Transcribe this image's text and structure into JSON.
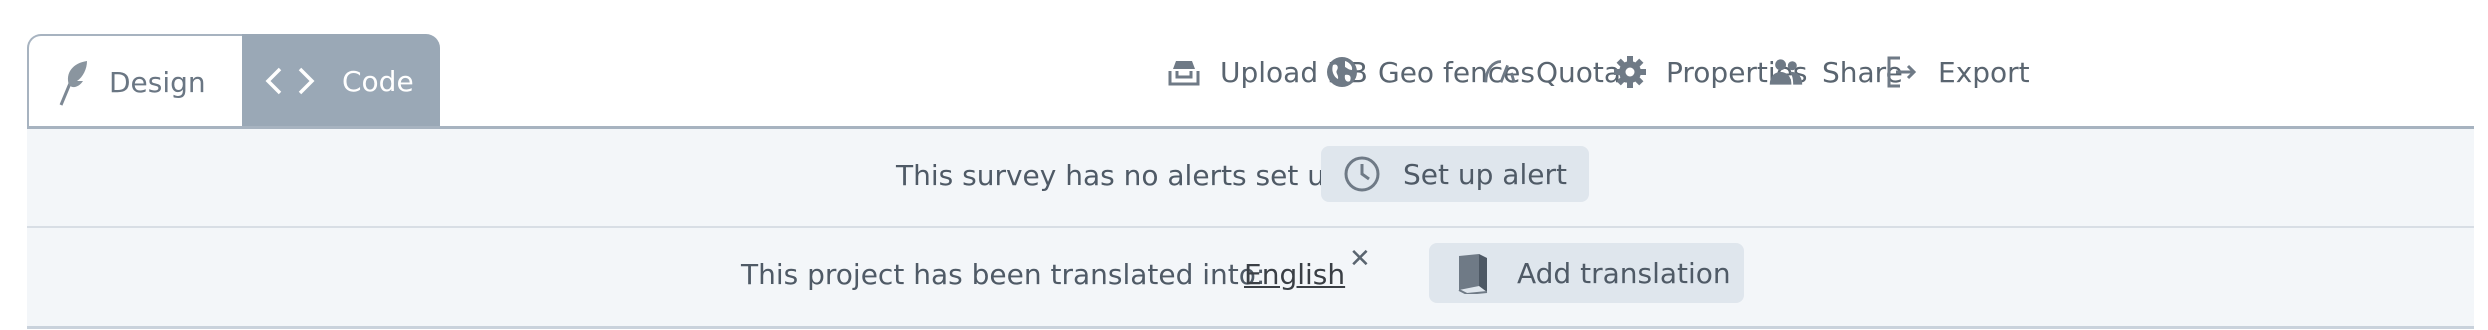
{
  "tabs": {
    "design_label": "Design",
    "code_label": "Code"
  },
  "toolbar": {
    "upload_db": "Upload DB",
    "geo_fences": "Geo fences",
    "quotas": "Quotas",
    "properties": "Properties",
    "share": "Share",
    "export": "Export"
  },
  "alerts_bar": {
    "message": "This survey has no alerts set up",
    "button_label": "Set up alert"
  },
  "translation_bar": {
    "message": "This project has been translated into:",
    "language": "English",
    "remove_symbol": "✕",
    "button_label": "Add translation"
  },
  "colors": {
    "tab_active_bg": "#9aa8b6",
    "bar_bg": "#f3f6f9",
    "button_bg": "#dfe6ed",
    "text": "#5a6570"
  }
}
